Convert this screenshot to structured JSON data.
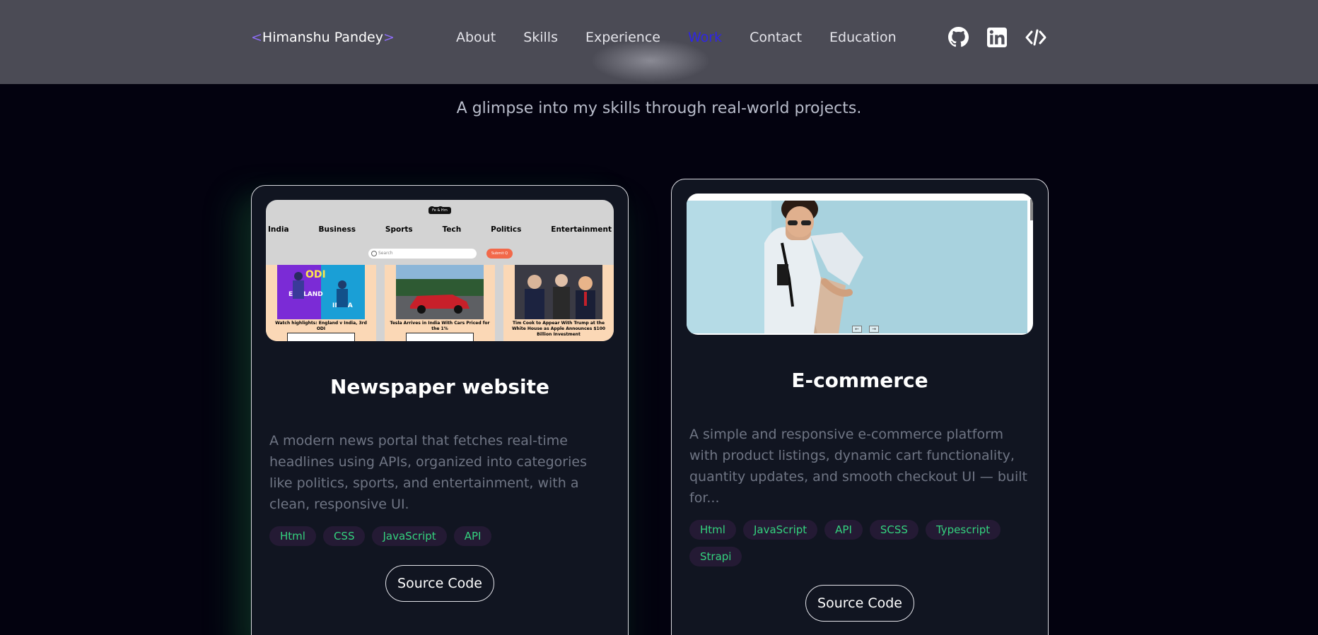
{
  "nav": {
    "logo_open": "<",
    "logo_name": "Himanshu Pandey",
    "logo_close": ">",
    "links": [
      "About",
      "Skills",
      "Experience",
      "Work",
      "Contact",
      "Education"
    ],
    "active": "Work",
    "icons": [
      "github-icon",
      "linkedin-icon",
      "code-icon"
    ]
  },
  "subtitle": "A glimpse into my skills through real-world projects.",
  "colors": {
    "accent_active": "#2f25e6",
    "tag_text": "#34d27e",
    "tag_bg": "#241a34",
    "bracket": "#8b6cf2"
  },
  "projects": [
    {
      "title": "Newspaper website",
      "description": "A modern news portal that fetches real-time headlines using APIs, organized into categories like politics, sports, and entertainment, with a clean, responsive UI.",
      "tags": [
        "Html",
        "CSS",
        "JavaScript",
        "API"
      ],
      "button": "Source Code",
      "preview": {
        "pill": "Fe & Hrn",
        "menu": [
          "India",
          "Business",
          "Sports",
          "Tech",
          "Politics",
          "Entertainment"
        ],
        "search_placeholder": "Search",
        "submit_label": "Submit Q",
        "articles": [
          "Watch highlights: England v India, 3rd ODI",
          "Tesla Arrives in India With Cars Priced for the 1%",
          "Tim Cook to Appear With Trump at the White House as Apple Announces $100 Billion Investment"
        ]
      }
    },
    {
      "title": "E-commerce",
      "description": "A simple and responsive e-commerce platform with product listings, dynamic cart functionality, quantity updates, and smooth checkout UI — built for...",
      "tags": [
        "Html",
        "JavaScript",
        "API",
        "SCSS",
        "Typescript",
        "Strapi"
      ],
      "button": "Source Code",
      "preview": {
        "arrows": [
          "←",
          "→"
        ]
      }
    }
  ]
}
